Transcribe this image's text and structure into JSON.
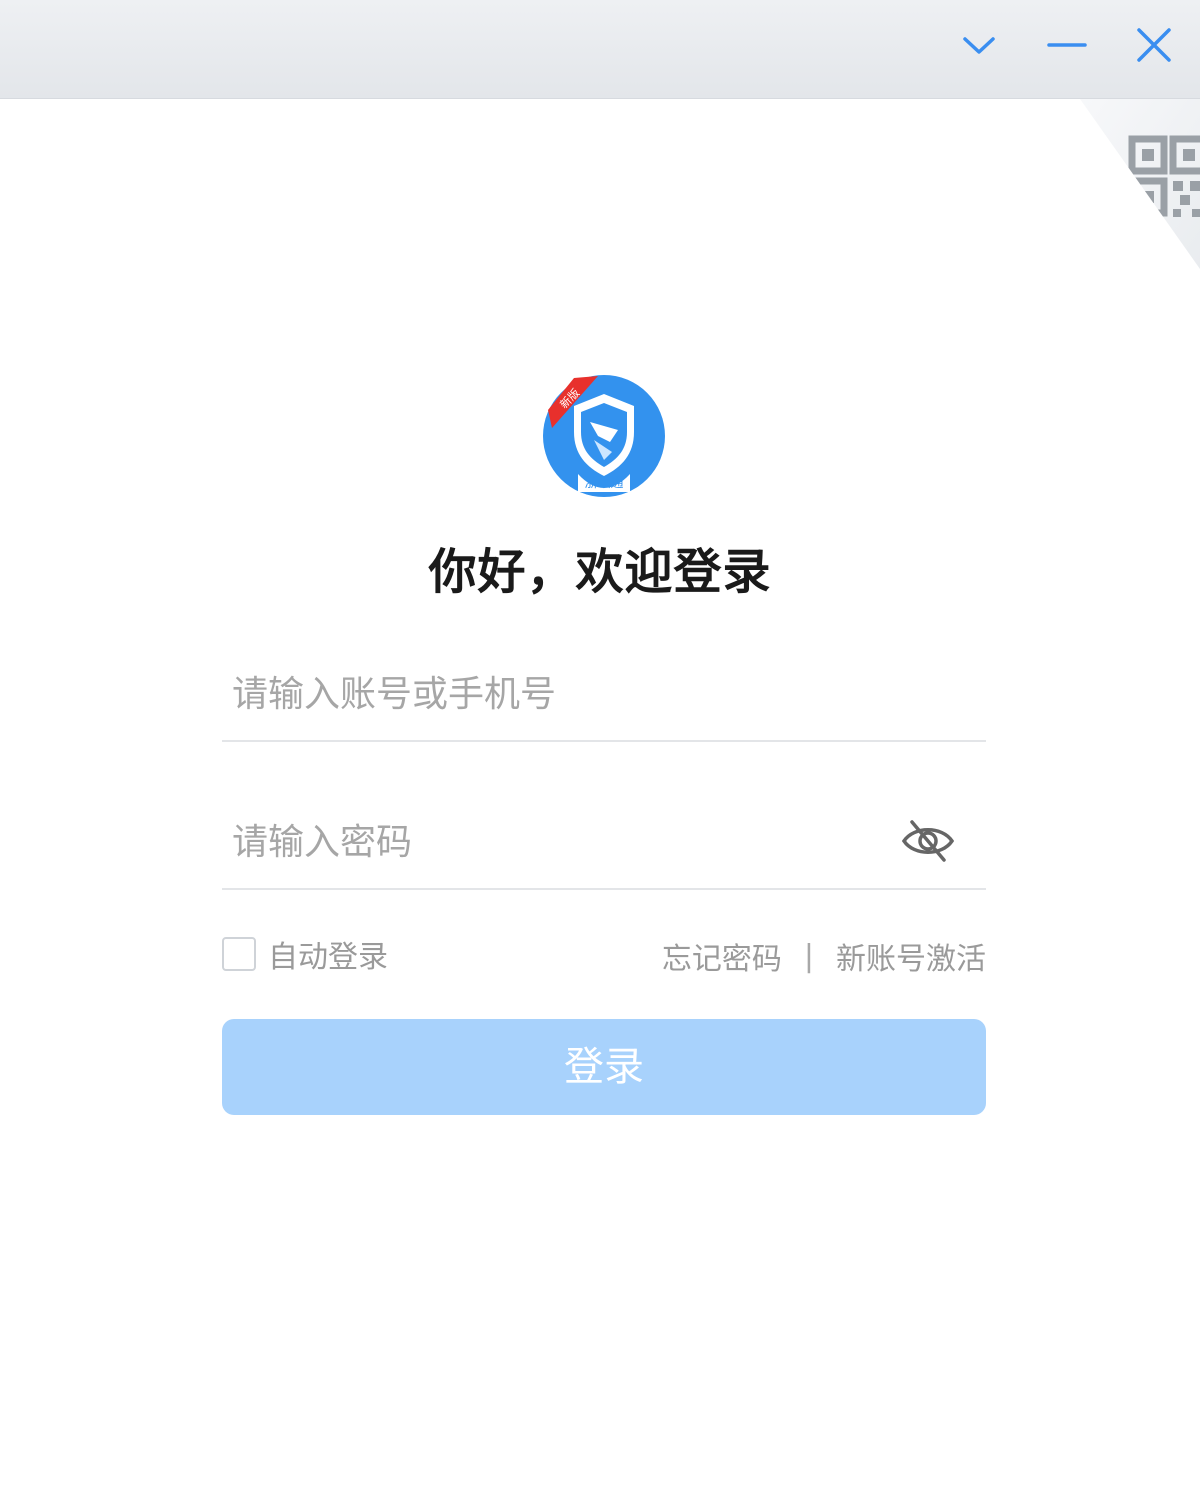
{
  "window": {
    "controls": [
      "collapse",
      "minimize",
      "close"
    ],
    "accent_color": "#3a8ef0"
  },
  "logo": {
    "ribbon_text": "新版",
    "caption": "浙政通"
  },
  "login": {
    "title": "你好，欢迎登录",
    "account_placeholder": "请输入账号或手机号",
    "password_placeholder": "请输入密码",
    "auto_login_label": "自动登录",
    "auto_login_checked": false,
    "forgot_password": "忘记密码",
    "separator": "|",
    "activate_account": "新账号激活",
    "submit_label": "登录",
    "submit_color": "#a8d2fc"
  },
  "icons": {
    "qr": "qr-code-icon",
    "password_visibility": "eye-slash-icon"
  }
}
